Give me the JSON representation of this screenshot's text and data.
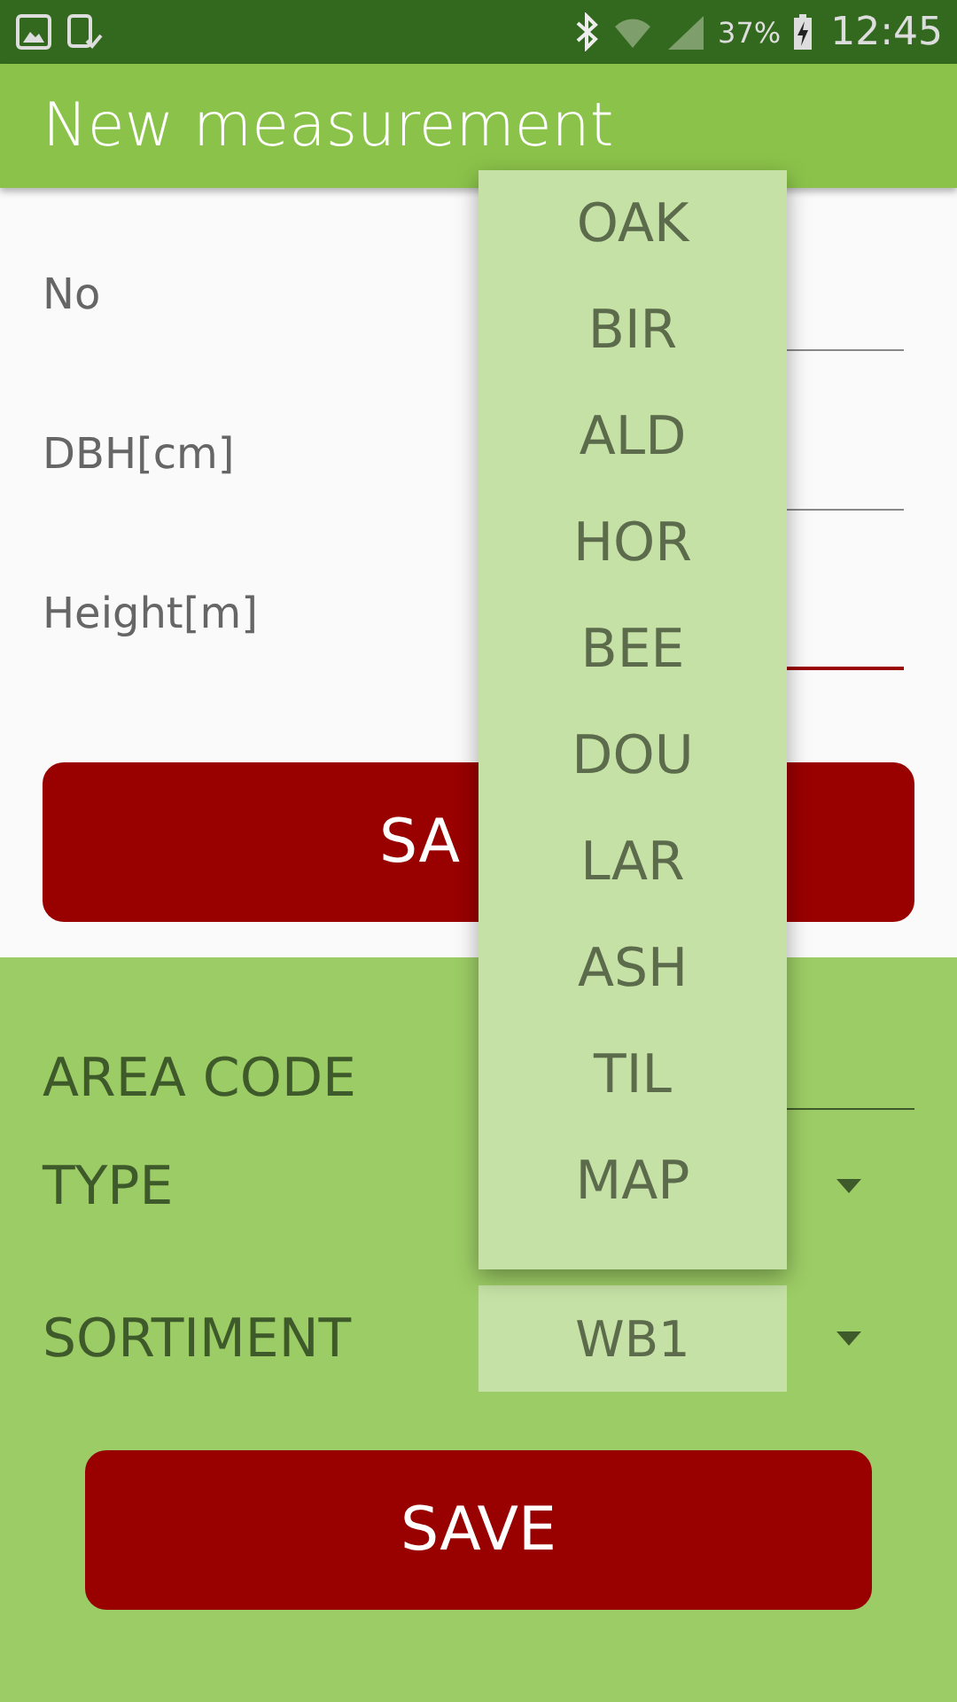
{
  "status_bar": {
    "battery": "37%",
    "time": "12:45"
  },
  "app_bar": {
    "title": "New measurement"
  },
  "tree_fields": [
    {
      "label": "No",
      "focused": false
    },
    {
      "label": "DBH[cm]",
      "focused": false
    },
    {
      "label": "Height[m]",
      "focused": true
    }
  ],
  "tree_save_button": "SA",
  "area_code": {
    "label": "AREA CODE"
  },
  "type": {
    "label": "TYPE"
  },
  "sortiment": {
    "label": "SORTIMENT",
    "value": "WB1"
  },
  "save_button": "SAVE",
  "type_dropdown": {
    "options": [
      "OAK",
      "BIR",
      "ALD",
      "HOR",
      "BEE",
      "DOU",
      "LAR",
      "ASH",
      "TIL",
      "MAP"
    ]
  }
}
